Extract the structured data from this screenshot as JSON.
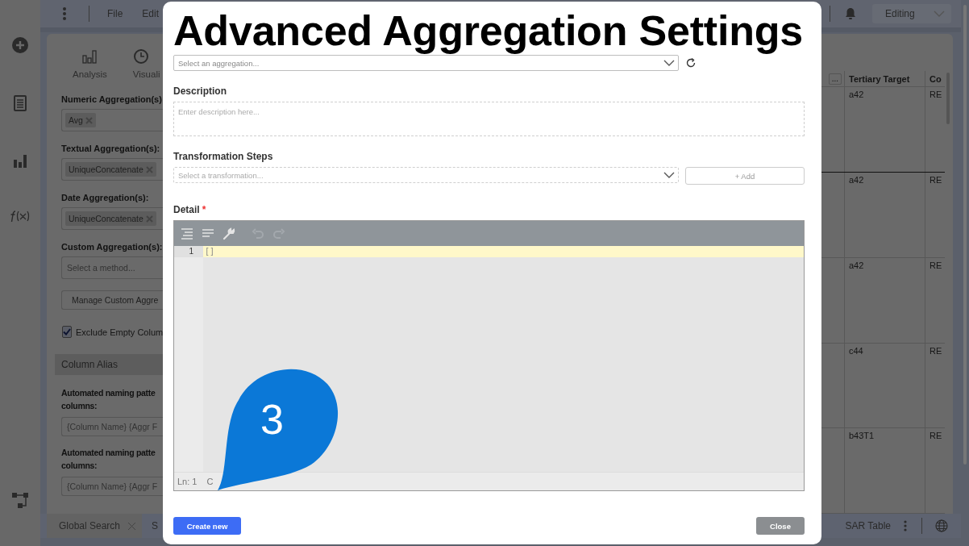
{
  "caption": "Advanced Aggregation Settings",
  "top_bar": {
    "menu": [
      "File",
      "Edit"
    ],
    "mode": "Editing"
  },
  "left_panel": {
    "tabs": [
      {
        "label": "Analysis"
      },
      {
        "label": "Visuali"
      }
    ],
    "items": [
      {
        "kind": "label",
        "text": "Numeric Aggregation(s)"
      },
      {
        "kind": "tags",
        "tags": [
          "Avg"
        ]
      },
      {
        "kind": "label",
        "text": "Textual Aggregation(s):"
      },
      {
        "kind": "tags",
        "tags": [
          "UniqueConcatenate"
        ]
      },
      {
        "kind": "label",
        "text": "Date Aggregation(s):"
      },
      {
        "kind": "tags",
        "tags": [
          "UniqueConcatenate"
        ]
      },
      {
        "kind": "label",
        "text": "Custom Aggregation(s):"
      },
      {
        "kind": "select",
        "placeholder": "Select a method..."
      },
      {
        "kind": "button",
        "text": "Manage Custom Aggre"
      },
      {
        "kind": "checkbox",
        "text": "Exclude Empty Colum",
        "checked": true
      },
      {
        "kind": "section",
        "text": "Column Alias"
      },
      {
        "kind": "label",
        "lines": [
          "Automated naming patte",
          "columns:"
        ]
      },
      {
        "kind": "text",
        "value": "{Column Name} {Aggr F"
      },
      {
        "kind": "label",
        "lines": [
          "Automated naming patte",
          "columns:"
        ]
      },
      {
        "kind": "text",
        "value": "{Column Name} {Aggr F"
      }
    ]
  },
  "table": {
    "more_button": "...",
    "columns": [
      "Tertiary Target",
      "Co"
    ],
    "rows": [
      [
        "a42",
        "RE"
      ],
      [
        "a42",
        "RE"
      ],
      [
        "a42",
        "RE"
      ],
      [
        "c44",
        "RE"
      ],
      [
        "b43T1",
        "RE"
      ]
    ]
  },
  "bottom_tabs": {
    "left": [
      {
        "label": "Global Search",
        "closable": true,
        "selected": true
      },
      {
        "label": "S",
        "closable": false,
        "selected": false
      }
    ],
    "right": "SAR Table"
  },
  "dialog": {
    "aggregation": {
      "placeholder": "Select an aggregation..."
    },
    "description": {
      "label": "Description",
      "placeholder": "Enter description here..."
    },
    "transformation": {
      "label": "Transformation Steps",
      "placeholder": "Select a transformation...",
      "add_button": "+ Add"
    },
    "detail": {
      "label": "Detail",
      "required_mark": "*",
      "line_number": "1",
      "code": "[]",
      "status": [
        "Ln: 1",
        "C"
      ]
    },
    "buttons": [
      {
        "label": "Create new",
        "kind": "primary"
      },
      {
        "label": "Close",
        "kind": "secondary"
      }
    ]
  },
  "callout": {
    "number": "3"
  }
}
